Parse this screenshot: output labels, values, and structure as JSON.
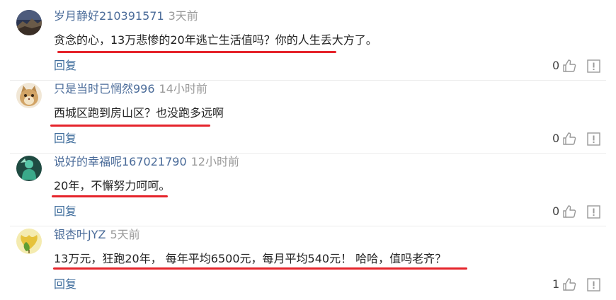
{
  "comments": [
    {
      "username": "岁月静好210391571",
      "time": "3天前",
      "content": "贪念的心，13万悲惨的20年逃亡生活值吗？你的人生丢大方了。",
      "reply_label": "回复",
      "likes": "0",
      "avatar": "night-mountain-avatar"
    },
    {
      "username": "只是当时已惘然996",
      "time": "14小时前",
      "content": "西城区跑到房山区？也没跑多远啊",
      "reply_label": "回复",
      "likes": "0",
      "avatar": "cat-avatar"
    },
    {
      "username": "说好的幸福呢167021790",
      "time": "12小时前",
      "content": "20年，不懈努力呵呵。",
      "reply_label": "回复",
      "likes": "0",
      "avatar": "green-figure-avatar"
    },
    {
      "username": "银杏叶JYZ",
      "time": "5天前",
      "content": "13万元，狂跑20年， 每年平均6500元，每月平均540元！ 哈哈，值吗老齐？",
      "reply_label": "回复",
      "likes": "1",
      "avatar": "ginkgo-leaf-avatar"
    }
  ],
  "colors": {
    "username": "#4a6b99",
    "time": "#999999",
    "reply": "#3f6d9c",
    "underline_annotation": "#e5242b"
  },
  "icons": {
    "like": "thumbs-up-icon",
    "report": "report-icon"
  }
}
